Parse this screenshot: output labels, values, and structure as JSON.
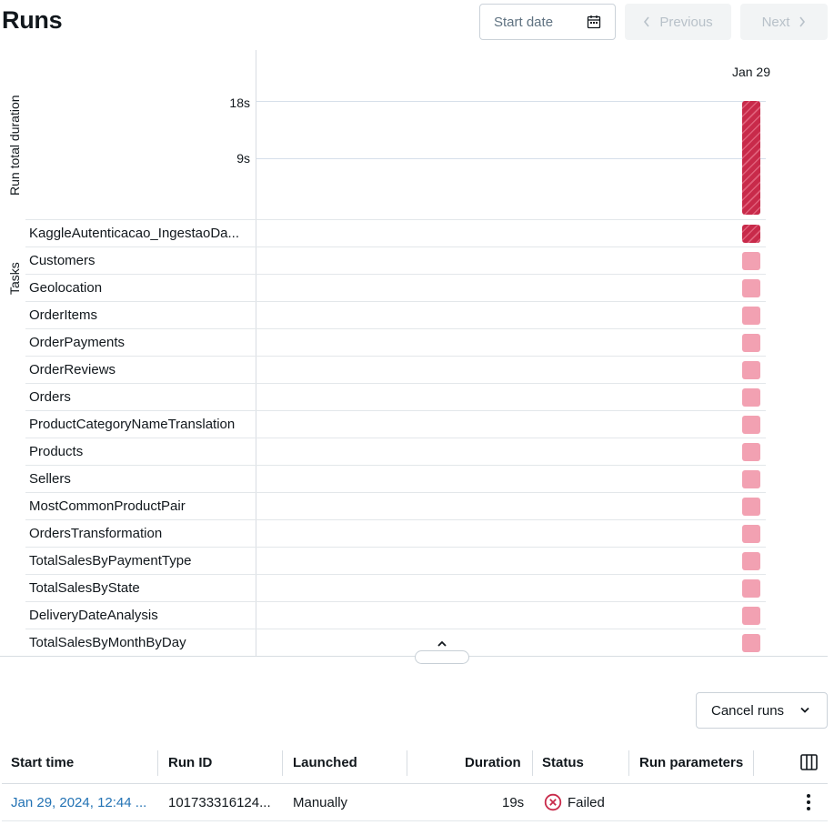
{
  "header": {
    "title": "Runs",
    "start_date_placeholder": "Start date",
    "previous_label": "Previous",
    "next_label": "Next"
  },
  "chart": {
    "y_axis_title": "Run total duration",
    "tasks_axis_title": "Tasks",
    "date_label": "Jan 29",
    "ticks": [
      "18s",
      "9s"
    ]
  },
  "chart_data": {
    "type": "bar",
    "categories": [
      "Jan 29"
    ],
    "values": [
      19
    ],
    "xlabel": "",
    "ylabel": "Run total duration",
    "yticks": [
      "9s",
      "18s"
    ],
    "status_colors": {
      "failed": "#c82a4a",
      "task": "#f2a1b2"
    }
  },
  "tasks": [
    {
      "name": "KaggleAutenticacao_IngestaoDa...",
      "status": "failed"
    },
    {
      "name": "Customers",
      "status": "skipped"
    },
    {
      "name": "Geolocation",
      "status": "skipped"
    },
    {
      "name": "OrderItems",
      "status": "skipped"
    },
    {
      "name": "OrderPayments",
      "status": "skipped"
    },
    {
      "name": "OrderReviews",
      "status": "skipped"
    },
    {
      "name": "Orders",
      "status": "skipped"
    },
    {
      "name": "ProductCategoryNameTranslation",
      "status": "skipped"
    },
    {
      "name": "Products",
      "status": "skipped"
    },
    {
      "name": "Sellers",
      "status": "skipped"
    },
    {
      "name": "MostCommonProductPair",
      "status": "skipped"
    },
    {
      "name": "OrdersTransformation",
      "status": "skipped"
    },
    {
      "name": "TotalSalesByPaymentType",
      "status": "skipped"
    },
    {
      "name": "TotalSalesByState",
      "status": "skipped"
    },
    {
      "name": "DeliveryDateAnalysis",
      "status": "skipped"
    },
    {
      "name": "TotalSalesByMonthByDay",
      "status": "skipped"
    }
  ],
  "actions": {
    "cancel_runs_label": "Cancel runs"
  },
  "table": {
    "columns": [
      "Start time",
      "Run ID",
      "Launched",
      "Duration",
      "Status",
      "Run parameters"
    ],
    "rows": [
      {
        "start_time": "Jan 29, 2024, 12:44 ...",
        "run_id": "101733316124...",
        "launched": "Manually",
        "duration": "19s",
        "status": "Failed",
        "run_parameters": ""
      }
    ]
  }
}
